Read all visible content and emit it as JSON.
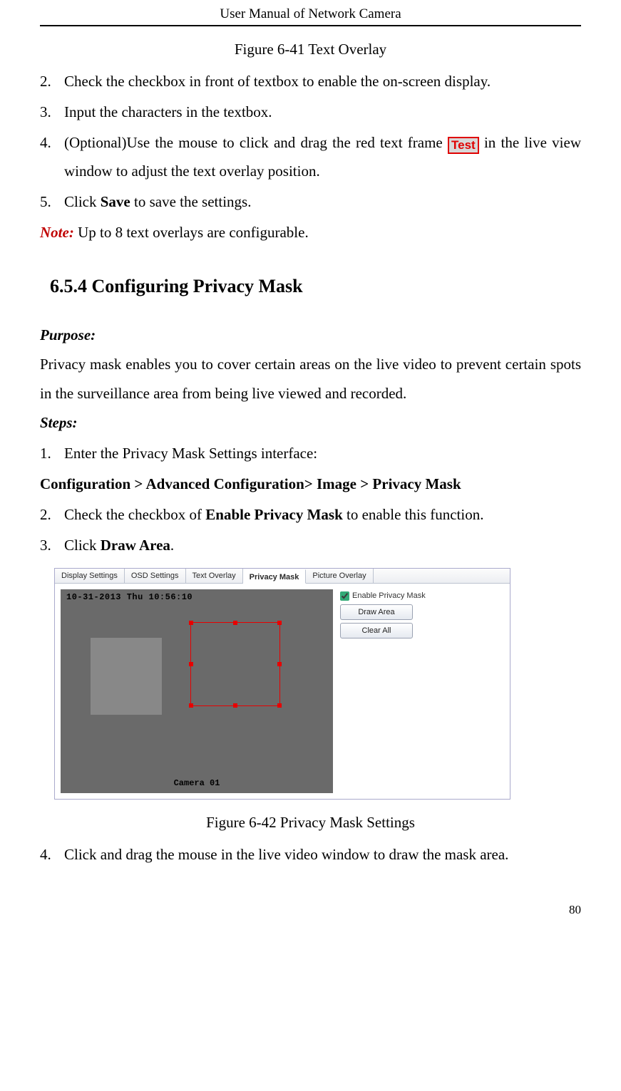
{
  "header": {
    "title": "User Manual of Network Camera"
  },
  "fig1": {
    "caption": "Figure 6-41 Text Overlay"
  },
  "listA": {
    "i2": {
      "num": "2.",
      "text": "Check the checkbox in front of textbox to enable the on-screen display."
    },
    "i3": {
      "num": "3.",
      "text": "Input the characters in the textbox."
    },
    "i4": {
      "num": "4.",
      "pre": "(Optional)Use the mouse to click and drag the red text frame ",
      "frame": "Test",
      "post": " in the live view window to adjust the text overlay position."
    },
    "i5": {
      "num": "5.",
      "pre": "Click ",
      "bold": "Save",
      "post": " to save the settings."
    }
  },
  "note": {
    "label": "Note:",
    "text": " Up to 8 text overlays are configurable."
  },
  "section": {
    "heading": "6.5.4   Configuring Privacy Mask"
  },
  "purpose": {
    "label": "Purpose:",
    "text": "Privacy mask enables you to cover certain areas on the live video to prevent certain spots in the surveillance area from being live viewed and recorded."
  },
  "steps": {
    "label": "Steps:"
  },
  "listB": {
    "i1": {
      "num": "1.",
      "text": "Enter the Privacy Mask Settings interface:"
    },
    "breadcrumb": "Configuration > Advanced Configuration> Image > Privacy Mask",
    "i2": {
      "num": "2.",
      "pre": "Check the checkbox of ",
      "bold": "Enable Privacy Mask",
      "post": " to enable this function."
    },
    "i3": {
      "num": "3.",
      "pre": "Click ",
      "bold": "Draw Area",
      "post": "."
    },
    "i4": {
      "num": "4.",
      "text": "Click and drag the mouse in the live video window to draw the mask area."
    }
  },
  "ui": {
    "tabs": {
      "t1": "Display Settings",
      "t2": "OSD Settings",
      "t3": "Text Overlay",
      "t4": "Privacy Mask",
      "t5": "Picture Overlay"
    },
    "osd_time": "10-31-2013 Thu 10:56:10",
    "osd_camera": "Camera 01",
    "checkbox_label": "Enable Privacy Mask",
    "btn_draw": "Draw Area",
    "btn_clear": "Clear All"
  },
  "fig2": {
    "caption": "Figure 6-42 Privacy Mask Settings"
  },
  "page": {
    "number": "80"
  }
}
